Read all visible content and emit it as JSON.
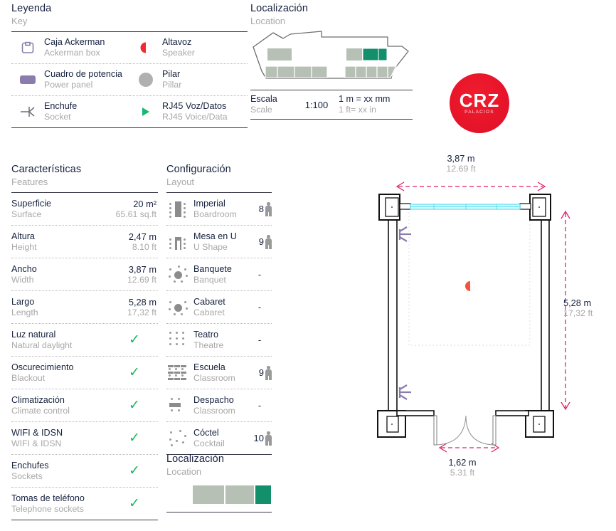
{
  "legend": {
    "title_es": "Leyenda",
    "title_en": "Key",
    "items": [
      {
        "icon": "ackerman-box-icon",
        "es": "Caja Ackerman",
        "en": "Ackerman box"
      },
      {
        "icon": "speaker-icon",
        "es": "Altavoz",
        "en": "Speaker"
      },
      {
        "icon": "power-panel-icon",
        "es": "Cuadro de potencia",
        "en": "Power panel"
      },
      {
        "icon": "pillar-icon",
        "es": "Pilar",
        "en": "Pillar"
      },
      {
        "icon": "socket-icon",
        "es": "Enchufe",
        "en": "Socket"
      },
      {
        "icon": "rj45-icon",
        "es": "RJ45 Voz/Datos",
        "en": "RJ45 Voice/Data"
      }
    ]
  },
  "location_top": {
    "title_es": "Localización",
    "title_en": "Location",
    "scale_label_es": "Escala",
    "scale_label_en": "Scale",
    "scale_value": "1:100",
    "conv_es": "1 m = xx mm",
    "conv_en": "1 ft= xx in"
  },
  "logo": {
    "main": "CRZ",
    "sub": "PALACIOS"
  },
  "features": {
    "title_es": "Características",
    "title_en": "Features",
    "rows": [
      {
        "es": "Superficie",
        "en": "Surface",
        "val_es": "20 m²",
        "val_en": "65.61 sq.ft",
        "check": false
      },
      {
        "es": "Altura",
        "en": "Height",
        "val_es": "2,47 m",
        "val_en": "8.10 ft",
        "check": false
      },
      {
        "es": "Ancho",
        "en": "Width",
        "val_es": "3,87 m",
        "val_en": "12.69 ft",
        "check": false
      },
      {
        "es": "Largo",
        "en": "Length",
        "val_es": "5,28 m",
        "val_en": "17,32 ft",
        "check": false
      },
      {
        "es": "Luz natural",
        "en": "Natural daylight",
        "val_es": "",
        "val_en": "",
        "check": true
      },
      {
        "es": "Oscurecimiento",
        "en": "Blackout",
        "val_es": "",
        "val_en": "",
        "check": true
      },
      {
        "es": "Climatización",
        "en": "Climate control",
        "val_es": "",
        "val_en": "",
        "check": true
      },
      {
        "es": "WIFI & IDSN",
        "en": "WIFI & IDSN",
        "val_es": "",
        "val_en": "",
        "check": true
      },
      {
        "es": "Enchufes",
        "en": "Sockets",
        "val_es": "",
        "val_en": "",
        "check": true
      },
      {
        "es": "Tomas de teléfono",
        "en": "Telephone sockets",
        "val_es": "",
        "val_en": "",
        "check": true
      }
    ],
    "check_glyph": "✓",
    "check_color": "#18b85a"
  },
  "layout": {
    "title_es": "Configuración",
    "title_en": "Layout",
    "rows": [
      {
        "icon": "boardroom-icon",
        "es": "Imperial",
        "en": "Boardroom",
        "capacity": "8"
      },
      {
        "icon": "ushape-icon",
        "es": "Mesa en U",
        "en": "U Shape",
        "capacity": "9"
      },
      {
        "icon": "banquet-icon",
        "es": "Banquete",
        "en": "Banquet",
        "capacity": "-"
      },
      {
        "icon": "cabaret-icon",
        "es": "Cabaret",
        "en": "Cabaret",
        "capacity": "-"
      },
      {
        "icon": "theatre-icon",
        "es": "Teatro",
        "en": "Theatre",
        "capacity": "-"
      },
      {
        "icon": "classroom-icon",
        "es": "Escuela",
        "en": "Classroom",
        "capacity": "9"
      },
      {
        "icon": "office-icon",
        "es": "Despacho",
        "en": "Classroom",
        "capacity": "-"
      },
      {
        "icon": "cocktail-icon",
        "es": "Cóctel",
        "en": "Cocktail",
        "capacity": "10"
      }
    ]
  },
  "location_bottom": {
    "title_es": "Localización",
    "title_en": "Location"
  },
  "floorplan": {
    "width_es": "3,87 m",
    "width_en": "12.69 ft",
    "length_es": "5,28 m",
    "length_en": "17,32 ft",
    "door_es": "1,62 m",
    "door_en": "5.31 ft"
  },
  "colors": {
    "accent_red": "#e8152a",
    "dim_pink": "#e0216b",
    "green": "#18b85a",
    "teal": "#13906b",
    "grey_block": "#b7c0b5",
    "purple": "#8a7cad",
    "window_cyan": "#5fe0ef"
  }
}
